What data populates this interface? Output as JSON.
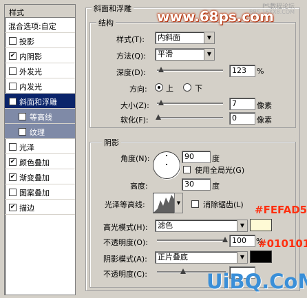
{
  "sidebar": {
    "header": "样式",
    "blend_label": "混合选项:自定",
    "items": [
      {
        "label": "投影",
        "checked": false
      },
      {
        "label": "内阴影",
        "checked": true
      },
      {
        "label": "外发光",
        "checked": false
      },
      {
        "label": "内发光",
        "checked": false
      },
      {
        "label": "斜面和浮雕",
        "checked": true
      },
      {
        "label": "等高线",
        "checked": false
      },
      {
        "label": "纹理",
        "checked": false
      },
      {
        "label": "光泽",
        "checked": false
      },
      {
        "label": "颜色叠加",
        "checked": true
      },
      {
        "label": "渐变叠加",
        "checked": true
      },
      {
        "label": "图案叠加",
        "checked": false
      },
      {
        "label": "描边",
        "checked": true
      }
    ]
  },
  "panel": {
    "title": "斜面和浮雕",
    "structure": {
      "title": "结构",
      "style_label": "样式(T):",
      "style_value": "内斜面",
      "method_label": "方法(Q):",
      "method_value": "平滑",
      "depth_label": "深度(D):",
      "depth_value": "123",
      "depth_unit": "%",
      "direction_label": "方向:",
      "dir_up": "上",
      "dir_down": "下",
      "size_label": "大小(Z):",
      "size_value": "7",
      "size_unit": "像素",
      "soften_label": "软化(F):",
      "soften_value": "0",
      "soften_unit": "像素"
    },
    "shading": {
      "title": "阴影",
      "angle_label": "角度(N):",
      "angle_value": "90",
      "angle_unit": "度",
      "global_light_label": "使用全局光(G)",
      "altitude_label": "高度:",
      "altitude_value": "30",
      "altitude_unit": "度",
      "gloss_label": "光泽等高线:",
      "antialias_label": "消除锯齿(L)",
      "highlight_mode_label": "高光模式(H):",
      "highlight_mode_value": "滤色",
      "highlight_color": "#FEFAD5",
      "highlight_opacity_label": "不透明度(O):",
      "highlight_opacity_value": "100",
      "highlight_opacity_unit": "%",
      "shadow_mode_label": "阴影模式(A):",
      "shadow_mode_value": "正片叠底",
      "shadow_color": "#010101",
      "shadow_opacity_label": "不透明度(C):"
    }
  },
  "overlays": {
    "site_watermark": "www.68ps.com",
    "corner_watermark": "PS教程论坛",
    "corner_watermark2": "BBS.16XX8.COM",
    "highlight_hex": "#FEFAD5",
    "shadow_hex": "#010101",
    "bottom_watermark": "UiBQ.CoM"
  }
}
